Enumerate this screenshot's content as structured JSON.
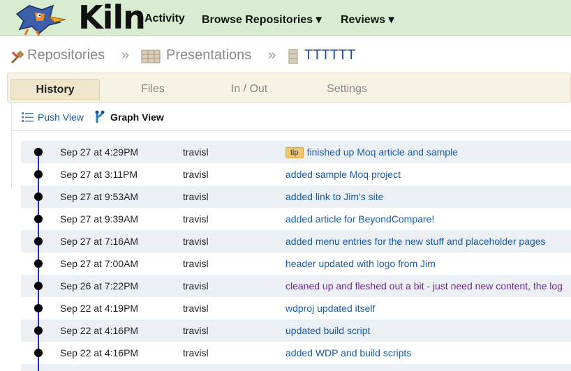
{
  "app": {
    "name": "Kiln"
  },
  "nav": [
    {
      "label": "Activity"
    },
    {
      "label": "Browse Repositories ▾"
    },
    {
      "label": "Reviews ▾"
    }
  ],
  "breadcrumb": {
    "items": [
      {
        "label": "Repositories",
        "icon": "repository-tools-icon"
      },
      {
        "label": "Presentations",
        "icon": "repository-group-icon"
      },
      {
        "label": "TTTTTT",
        "icon": "repository-icon"
      }
    ],
    "separator": "»"
  },
  "tabs": [
    {
      "label": "History",
      "active": true
    },
    {
      "label": "Files",
      "active": false
    },
    {
      "label": "In / Out",
      "active": false
    },
    {
      "label": "Settings",
      "active": false
    }
  ],
  "views": {
    "push": {
      "label": "Push View"
    },
    "graph": {
      "label": "Graph View"
    }
  },
  "history": [
    {
      "date": "Sep 27 at 4:29PM",
      "author": "travisl",
      "badge": "tip",
      "message": "finished up Moq article and sample",
      "visited": false
    },
    {
      "date": "Sep 27 at 3:11PM",
      "author": "travisl",
      "badge": "",
      "message": "added sample Moq project",
      "visited": false
    },
    {
      "date": "Sep 27 at 9:53AM",
      "author": "travisl",
      "badge": "",
      "message": "added link to Jim's site",
      "visited": false
    },
    {
      "date": "Sep 27 at 9:39AM",
      "author": "travisl",
      "badge": "",
      "message": "added article for BeyondCompare!",
      "visited": false
    },
    {
      "date": "Sep 27 at 7:16AM",
      "author": "travisl",
      "badge": "",
      "message": "added menu entries for the new stuff and placeholder pages",
      "visited": false
    },
    {
      "date": "Sep 27 at 7:00AM",
      "author": "travisl",
      "badge": "",
      "message": "header updated with logo from Jim",
      "visited": false
    },
    {
      "date": "Sep 26 at 7:22PM",
      "author": "travisl",
      "badge": "",
      "message": "cleaned up and fleshed out a bit - just need new content, the log",
      "visited": true
    },
    {
      "date": "Sep 22 at 4:19PM",
      "author": "travisl",
      "badge": "",
      "message": "wdproj updated itself",
      "visited": false
    },
    {
      "date": "Sep 22 at 4:16PM",
      "author": "travisl",
      "badge": "",
      "message": "updated build script",
      "visited": false
    },
    {
      "date": "Sep 22 at 4:16PM",
      "author": "travisl",
      "badge": "",
      "message": "added WDP and build scripts",
      "visited": false
    },
    {
      "date": "",
      "author": "",
      "badge": "",
      "message": "",
      "visited": false
    }
  ],
  "colors": {
    "topbar": "#d7ecd0",
    "link": "#1b5aa3",
    "visited_link": "#6b2a8a",
    "graph_line": "#1f2fd0",
    "tip_badge": "#f0c66a",
    "row_alt": "#ecf0f5"
  }
}
